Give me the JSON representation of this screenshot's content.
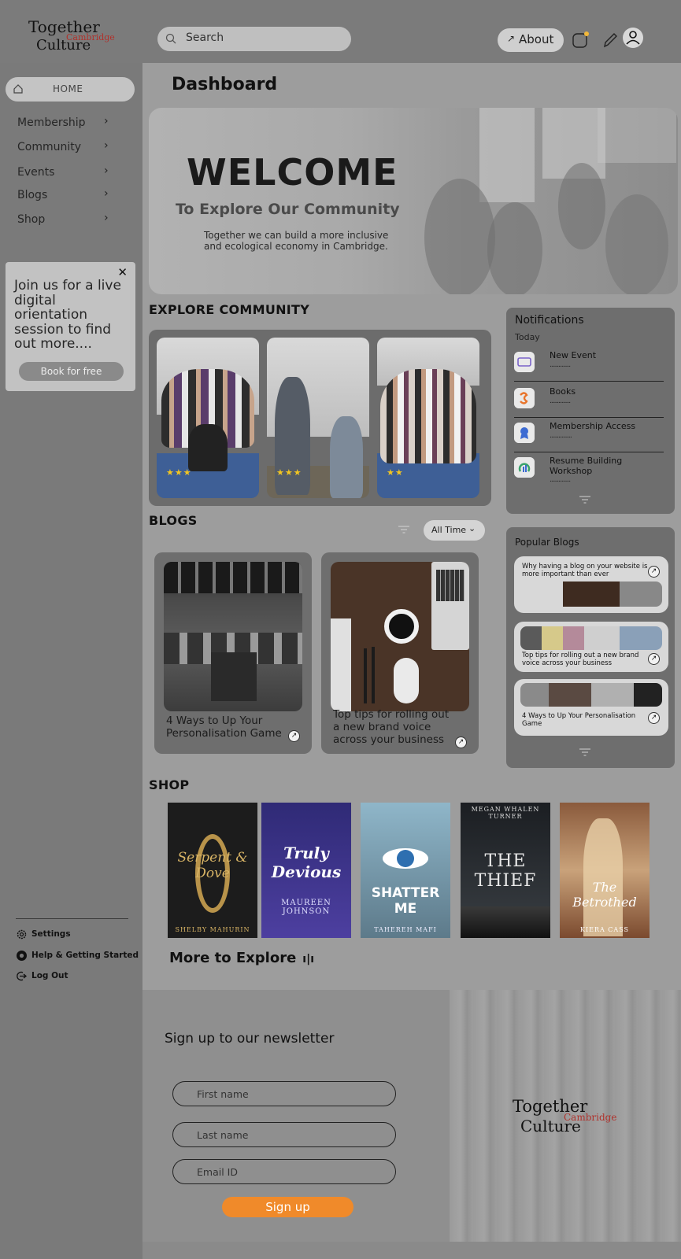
{
  "brand": {
    "line1": "Together",
    "line2": "Culture",
    "city": "Cambridge"
  },
  "header": {
    "search_placeholder": "Search",
    "about_label": "About"
  },
  "sidebar": {
    "home": "HOME",
    "items": [
      {
        "label": "Membership"
      },
      {
        "label": "Community"
      },
      {
        "label": "Events"
      },
      {
        "label": "Blogs"
      },
      {
        "label": "Shop"
      }
    ],
    "promo": {
      "text": "Join us for a live digital orientation session to find out more....",
      "button": "Book for free"
    },
    "links": {
      "settings": "Settings",
      "help": "Help & Getting Started",
      "logout": "Log Out"
    }
  },
  "main": {
    "title": "Dashboard",
    "hero": {
      "welcome": "WELCOME",
      "subtitle": "To Explore Our Community",
      "description": "Together we can build a more inclusive and ecological economy in Cambridge."
    },
    "explore": {
      "title": "EXPLORE COMMUNITY",
      "stars": [
        "★★★",
        "★★★",
        "★★"
      ]
    },
    "notifications": {
      "title": "Notifications",
      "group": "Today",
      "items": [
        {
          "label": "New Event",
          "dots": "..............",
          "icon": "event-icon",
          "color": "#7a63c9"
        },
        {
          "label": "Books",
          "dots": "..............",
          "icon": "books-icon",
          "color": "#e8742b"
        },
        {
          "label": "Membership  Access",
          "dots": "...............",
          "icon": "membership-icon",
          "color": "#3c6bd2"
        },
        {
          "label": "Resume Building Workshop",
          "dots": "..............",
          "icon": "chart-icon",
          "color": "#3aa36c"
        }
      ]
    },
    "blogs": {
      "title": "BLOGS",
      "filter": "All Time",
      "cards": [
        {
          "title": "4 Ways to Up Your Personalisation Game"
        },
        {
          "title": "Top tips for rolling out a new brand voice across your business"
        }
      ]
    },
    "popular": {
      "title": "Popular Blogs",
      "items": [
        {
          "title": "Why having a blog on your website is more important than ever"
        },
        {
          "title": "Top tips for rolling out a new brand voice across your business"
        },
        {
          "title": "4 Ways to Up Your Personalisation Game"
        }
      ]
    },
    "shop": {
      "title": "SHOP",
      "books": [
        {
          "title": "Serpent & Dove",
          "author": "SHELBY MAHURIN"
        },
        {
          "title": "Truly Devious",
          "author": "MAUREEN JOHNSON"
        },
        {
          "title": "SHATTER ME",
          "author": "TAHEREH MAFI"
        },
        {
          "title": "THE THIEF",
          "author": "MEGAN WHALEN TURNER"
        },
        {
          "title": "The Betrothed",
          "author": "KIERA CASS"
        }
      ],
      "more": "More to Explore"
    }
  },
  "newsletter": {
    "title": "Sign up to our newsletter",
    "fields": {
      "first": "First name",
      "last": "Last name",
      "email": "Email ID"
    },
    "button": "Sign up"
  },
  "colors": {
    "accent": "#f08a2a",
    "brand_red": "#b0322c"
  }
}
